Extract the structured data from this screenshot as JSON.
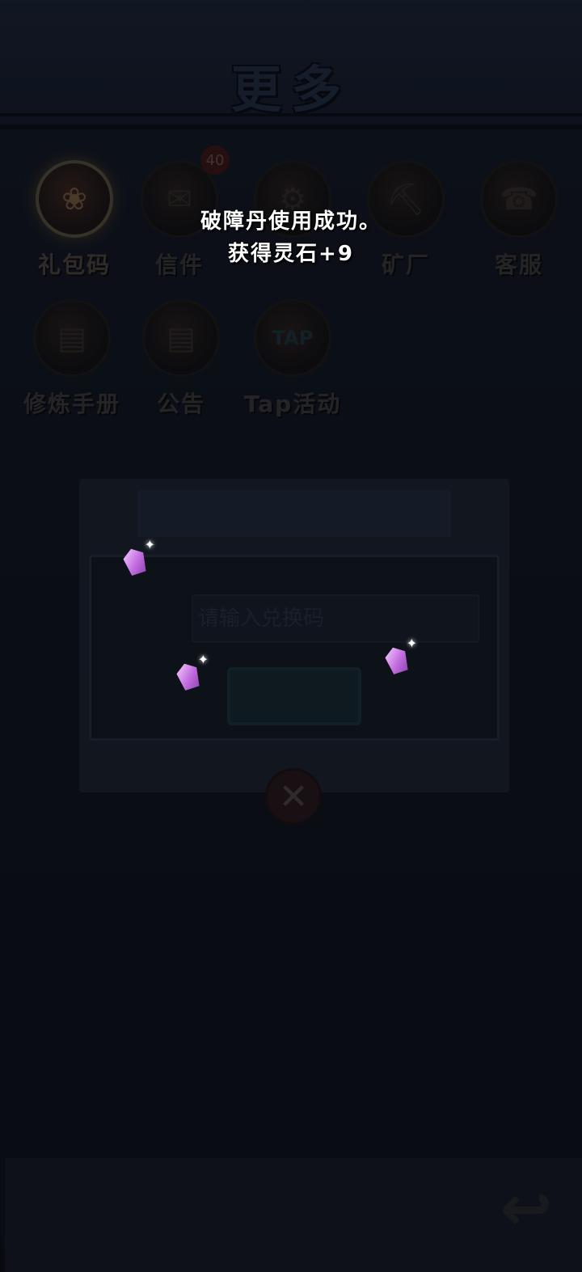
{
  "header": {
    "title": "更多"
  },
  "menu": {
    "items": [
      {
        "key": "gift-code",
        "label": "礼包码",
        "icon": "gift-bag-icon",
        "active": true
      },
      {
        "key": "mail",
        "label": "信件",
        "icon": "mail-icon",
        "badge": "40"
      },
      {
        "key": "settings",
        "label": "",
        "icon": "gear-icon"
      },
      {
        "key": "mine",
        "label": "矿厂",
        "icon": "mine-cart-icon"
      },
      {
        "key": "service",
        "label": "客服",
        "icon": "service-icon"
      },
      {
        "key": "manual",
        "label": "修炼手册",
        "icon": "scroll-icon"
      },
      {
        "key": "notice",
        "label": "公告",
        "icon": "notice-scroll-icon"
      },
      {
        "key": "tap",
        "label": "Tap活动",
        "icon": "tap-icon",
        "icon_text": "TAP"
      }
    ]
  },
  "toast": {
    "line1": "破障丹使用成功。",
    "line2": "获得灵石+9"
  },
  "dialog": {
    "input_placeholder": "请输入兑换码"
  },
  "icons": {
    "close": "close-icon",
    "back": "back-arrow-icon",
    "crystal": "spirit-stone-icon"
  },
  "colors": {
    "toast_text": "#ffffff",
    "crystal": "#c46ee0",
    "active_ring": "#8a7a57"
  }
}
